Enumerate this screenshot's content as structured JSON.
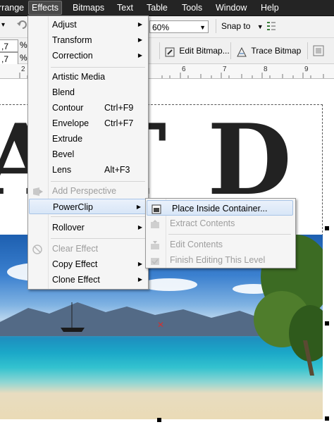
{
  "menubar": {
    "items": [
      "rrange",
      "Effects",
      "Bitmaps",
      "Text",
      "Table",
      "Tools",
      "Window",
      "Help"
    ]
  },
  "toolbar1": {
    "field1": ",7",
    "field2": ",7",
    "unit1": "%",
    "unit2": "%",
    "zoom": "60%",
    "snap_label": "Snap to"
  },
  "toolbar2": {
    "edit_bitmap": "Edit Bitmap...",
    "trace_bitmap": "Trace Bitmap"
  },
  "ruler": {
    "numbers": [
      "2",
      "6",
      "7",
      "8",
      "9"
    ]
  },
  "canvas": {
    "big_text": "ATD"
  },
  "effects_menu": {
    "items": [
      {
        "label": "Adjust",
        "shortcut": "",
        "submenu": true,
        "disabled": false
      },
      {
        "label": "Transform",
        "shortcut": "",
        "submenu": true,
        "disabled": false
      },
      {
        "label": "Correction",
        "shortcut": "",
        "submenu": true,
        "disabled": false
      },
      {
        "label": "Artistic Media",
        "shortcut": "",
        "submenu": false,
        "disabled": false
      },
      {
        "label": "Blend",
        "shortcut": "",
        "submenu": false,
        "disabled": false
      },
      {
        "label": "Contour",
        "shortcut": "Ctrl+F9",
        "submenu": false,
        "disabled": false
      },
      {
        "label": "Envelope",
        "shortcut": "Ctrl+F7",
        "submenu": false,
        "disabled": false
      },
      {
        "label": "Extrude",
        "shortcut": "",
        "submenu": false,
        "disabled": false
      },
      {
        "label": "Bevel",
        "shortcut": "",
        "submenu": false,
        "disabled": false
      },
      {
        "label": "Lens",
        "shortcut": "Alt+F3",
        "submenu": false,
        "disabled": false
      },
      {
        "label": "Add Perspective",
        "shortcut": "",
        "submenu": false,
        "disabled": true
      },
      {
        "label": "PowerClip",
        "shortcut": "",
        "submenu": true,
        "disabled": false
      },
      {
        "label": "Rollover",
        "shortcut": "",
        "submenu": true,
        "disabled": false
      },
      {
        "label": "Clear Effect",
        "shortcut": "",
        "submenu": false,
        "disabled": true
      },
      {
        "label": "Copy Effect",
        "shortcut": "",
        "submenu": true,
        "disabled": false
      },
      {
        "label": "Clone Effect",
        "shortcut": "",
        "submenu": true,
        "disabled": false
      }
    ]
  },
  "powerclip_menu": {
    "items": [
      {
        "label": "Place Inside Container...",
        "disabled": false
      },
      {
        "label": "Extract Contents",
        "disabled": true
      },
      {
        "label": "Edit Contents",
        "disabled": true
      },
      {
        "label": "Finish Editing This Level",
        "disabled": true
      }
    ]
  },
  "colors": {
    "menubar_bg": "#242424",
    "menu_bg": "#f5f5f5",
    "highlight": "#d8e6f7",
    "disabled_text": "#9d9d9d"
  }
}
